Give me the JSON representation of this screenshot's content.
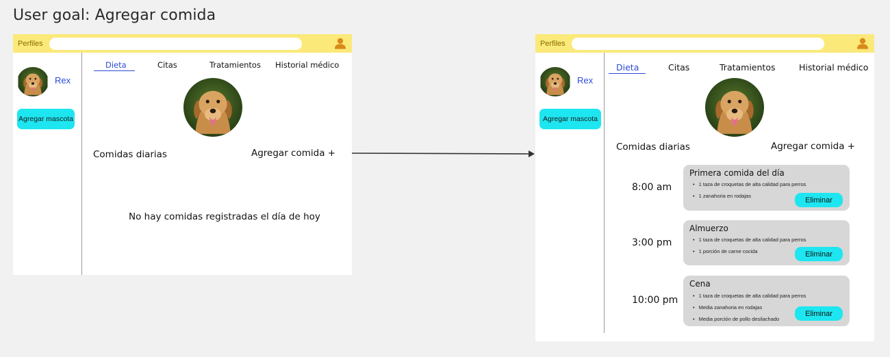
{
  "goal": "User goal: Agregar comida",
  "colors": {
    "topbar": "#fbe97a",
    "accent": "#1ee6f0",
    "link": "#2a4ad8",
    "card": "#d7d7d7",
    "user_icon": "#d98a1a"
  },
  "icons": [
    "user-profile-icon",
    "arrow-right-icon"
  ],
  "before": {
    "brand": "Perfiles",
    "search_placeholder": "",
    "pet_name": "Rex",
    "add_pet": "Agregar mascota",
    "tabs": [
      "Dieta",
      "Citas",
      "Tratamientos",
      "Historial médico"
    ],
    "section_title": "Comidas diarias",
    "add_meal": "Agregar comida +",
    "empty": "No hay comidas registradas el día de hoy"
  },
  "after": {
    "brand": "Perfiles",
    "search_placeholder": "",
    "pet_name": "Rex",
    "add_pet": "Agregar mascota",
    "tabs": [
      "Dieta",
      "Citas",
      "Tratamientos",
      "Historial médico"
    ],
    "section_title": "Comidas diarias",
    "add_meal": "Agregar comida +",
    "meals": [
      {
        "time": "8:00 am",
        "title": "Primera comida del día",
        "items": [
          "1 taza de croquetas de alta calidad para perros",
          "1 zanahoria en rodajas"
        ],
        "action": "Eliminar"
      },
      {
        "time": "3:00 pm",
        "title": "Almuerzo",
        "items": [
          "1 taza de croquetas de alta calidad para perros",
          "1 porción de carne cocida"
        ],
        "action": "Eliminar"
      },
      {
        "time": "10:00 pm",
        "title": "Cena",
        "items": [
          "1 taza de croquetas de alta calidad para perros",
          "Media zanahoria en rodajas",
          "Media porción de pollo desilachado"
        ],
        "action": "Eliminar"
      }
    ]
  }
}
